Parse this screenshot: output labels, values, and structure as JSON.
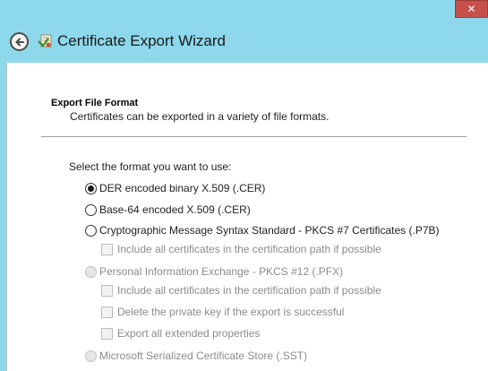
{
  "window": {
    "title": "Certificate Export Wizard",
    "close_glyph": "✕"
  },
  "section": {
    "heading": "Export File Format",
    "subtitle": "Certificates can be exported in a variety of file formats."
  },
  "prompt": "Select the format you want to use:",
  "formats": [
    {
      "label": "DER encoded binary X.509 (.CER)",
      "selected": true,
      "enabled": true
    },
    {
      "label": "Base-64 encoded X.509 (.CER)",
      "selected": false,
      "enabled": true
    },
    {
      "label": "Cryptographic Message Syntax Standard - PKCS #7 Certificates (.P7B)",
      "selected": false,
      "enabled": true
    },
    {
      "label": "Personal Information Exchange - PKCS #12 (.PFX)",
      "selected": false,
      "enabled": false
    },
    {
      "label": "Microsoft Serialized Certificate Store (.SST)",
      "selected": false,
      "enabled": false
    }
  ],
  "p7b_options": [
    {
      "label": "Include all certificates in the certification path if possible",
      "checked": false,
      "enabled": false
    }
  ],
  "pfx_options": [
    {
      "label": "Include all certificates in the certification path if possible",
      "checked": false,
      "enabled": false
    },
    {
      "label": "Delete the private key if the export is successful",
      "checked": false,
      "enabled": false
    },
    {
      "label": "Export all extended properties",
      "checked": false,
      "enabled": false
    }
  ],
  "colors": {
    "titlebar": "#8ed8ec",
    "close_button": "#c7504b",
    "disabled_text": "#8b8b8b"
  }
}
